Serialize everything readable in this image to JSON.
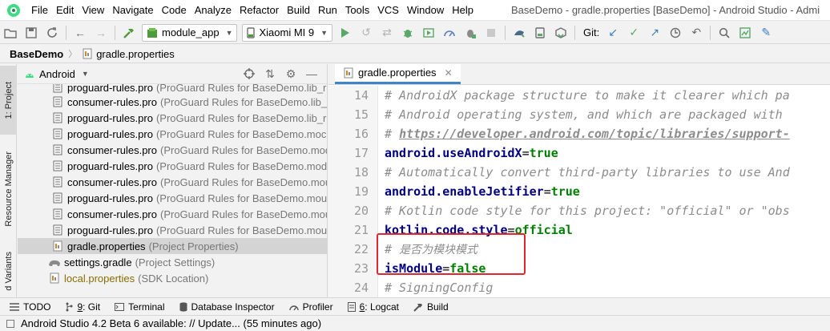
{
  "menubar": {
    "items": [
      "File",
      "Edit",
      "View",
      "Navigate",
      "Code",
      "Analyze",
      "Refactor",
      "Build",
      "Run",
      "Tools",
      "VCS",
      "Window",
      "Help"
    ],
    "window_title": "BaseDemo - gradle.properties [BaseDemo] - Android Studio - Admi"
  },
  "toolbar": {
    "module_combo": "module_app",
    "device_combo": "Xiaomi MI 9",
    "git_label": "Git:"
  },
  "breadcrumb": {
    "project": "BaseDemo",
    "file": "gradle.properties"
  },
  "left_strip": {
    "tabs": [
      "1: Project",
      "Resource Manager",
      "d Variants"
    ]
  },
  "project_panel": {
    "view_mode": "Android",
    "rows": [
      {
        "name": "proguard-rules.pro",
        "desc": "(ProGuard Rules for BaseDemo.lib_r"
      },
      {
        "name": "consumer-rules.pro",
        "desc": "(ProGuard Rules for BaseDemo.lib_r"
      },
      {
        "name": "proguard-rules.pro",
        "desc": "(ProGuard Rules for BaseDemo.lib_r"
      },
      {
        "name": "proguard-rules.pro",
        "desc": "(ProGuard Rules for BaseDemo.moc"
      },
      {
        "name": "consumer-rules.pro",
        "desc": "(ProGuard Rules for BaseDemo.mod"
      },
      {
        "name": "proguard-rules.pro",
        "desc": "(ProGuard Rules for BaseDemo.mod"
      },
      {
        "name": "consumer-rules.pro",
        "desc": "(ProGuard Rules for BaseDemo.mou"
      },
      {
        "name": "proguard-rules.pro",
        "desc": "(ProGuard Rules for BaseDemo.mou"
      },
      {
        "name": "consumer-rules.pro",
        "desc": "(ProGuard Rules for BaseDemo.mou"
      },
      {
        "name": "proguard-rules.pro",
        "desc": "(ProGuard Rules for BaseDemo.mou"
      },
      {
        "name": "gradle.properties",
        "desc": "(Project Properties)"
      },
      {
        "name": "settings.gradle",
        "desc": "(Project Settings)"
      },
      {
        "name": "local.properties",
        "desc": "(SDK Location)"
      }
    ]
  },
  "editor": {
    "tab_label": "gradle.properties",
    "lines": [
      {
        "num": "14",
        "comment": "# AndroidX package structure to make it clearer which pa"
      },
      {
        "num": "15",
        "comment": "# Android operating system, and which are packaged with"
      },
      {
        "num": "16",
        "comment_prefix": "# ",
        "url": "https://developer.android.com/topic/libraries/support-"
      },
      {
        "num": "17",
        "key": "android.useAndroidX",
        "eq": "=",
        "value": "true"
      },
      {
        "num": "18",
        "comment": "# Automatically convert third-party libraries to use And"
      },
      {
        "num": "19",
        "key": "android.enableJetifier",
        "eq": "=",
        "value": "true"
      },
      {
        "num": "20",
        "comment": "# Kotlin code style for this project: \"official\" or \"obs"
      },
      {
        "num": "21",
        "key": "kotlin.code.style",
        "eq": "=",
        "value": "official"
      },
      {
        "num": "22",
        "comment_prefix": "# ",
        "cjk": "是否为模块模式"
      },
      {
        "num": "23",
        "key": "isModule",
        "eq": "=",
        "value": "false"
      },
      {
        "num": "24",
        "comment": "# SigningConfig"
      }
    ]
  },
  "bottom_tabs": [
    {
      "label": "TODO"
    },
    {
      "num": "9",
      "label": ": Git"
    },
    {
      "label": "Terminal"
    },
    {
      "label": "Database Inspector"
    },
    {
      "label": "Profiler"
    },
    {
      "num": "6",
      "label": ": Logcat"
    },
    {
      "label": "Build"
    }
  ],
  "status_bar": {
    "message": "Android Studio 4.2 Beta 6 available: // Update... (55 minutes ago)"
  },
  "colors": {
    "accent_tab": "#4083c9",
    "highlight_box": "#e0262f",
    "keyword": "#000080",
    "value": "#008000",
    "comment": "#8c8c8c"
  }
}
